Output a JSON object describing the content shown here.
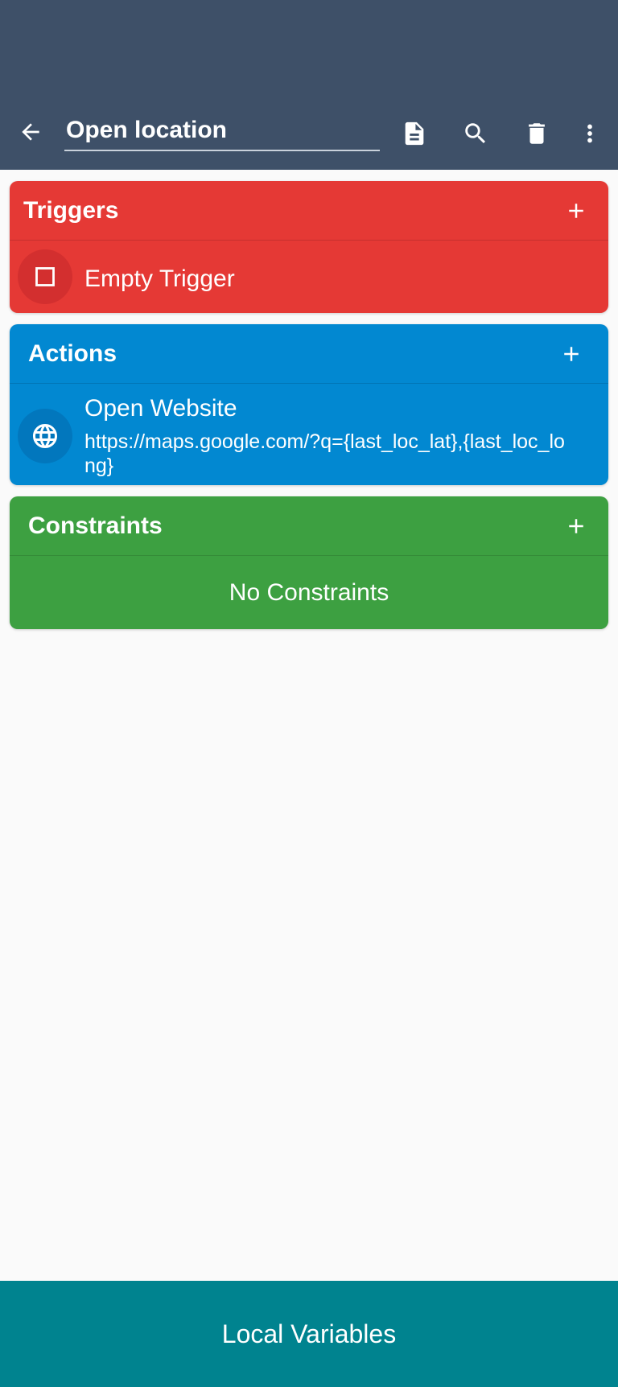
{
  "toolbar": {
    "title_value": "Open location",
    "back_icon": "arrow-left-icon",
    "doc_icon": "document-icon",
    "search_icon": "search-icon",
    "delete_icon": "trash-icon",
    "more_icon": "more-vert-icon",
    "background": "#3e5068"
  },
  "triggers": {
    "header": "Triggers",
    "color": "#e53935",
    "items": [
      {
        "title": "Empty Trigger",
        "icon": "checkbox-outline-icon"
      }
    ]
  },
  "actions": {
    "header": "Actions",
    "color": "#0288d1",
    "items": [
      {
        "title": "Open Website",
        "detail": "https://maps.google.com/?q={last_loc_lat},{last_loc_long}",
        "icon": "globe-icon"
      }
    ]
  },
  "constraints": {
    "header": "Constraints",
    "color": "#3da041",
    "empty_text": "No Constraints"
  },
  "footer": {
    "label": "Local Variables",
    "color": "#00838f"
  }
}
